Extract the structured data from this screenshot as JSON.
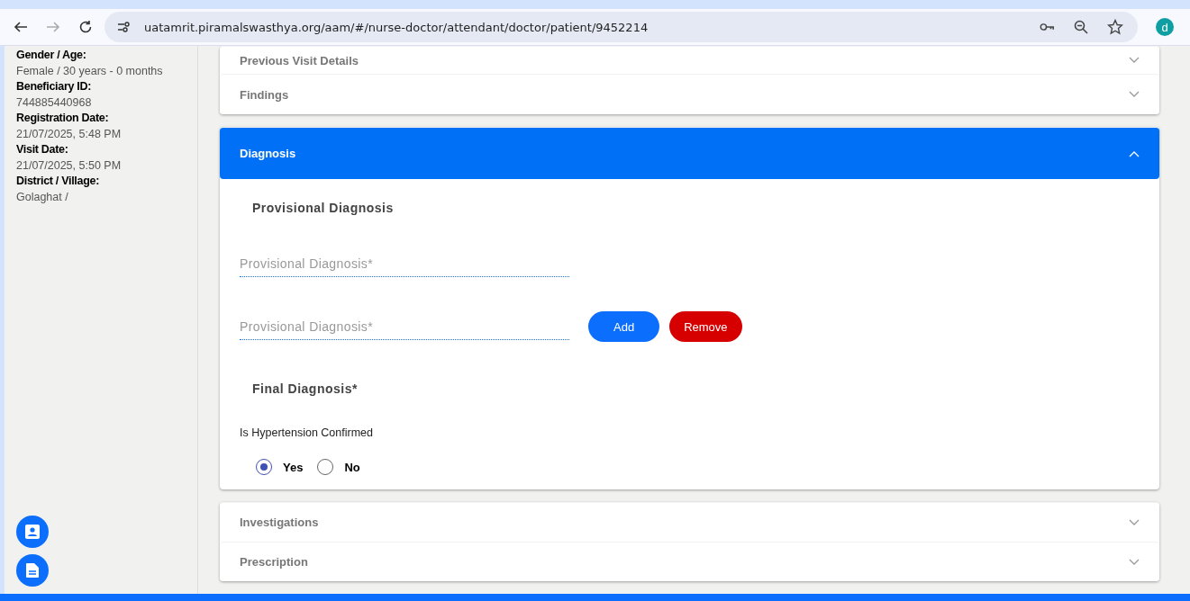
{
  "browser": {
    "url": "uatamrit.piramalswasthya.org/aam/#/nurse-doctor/attendant/doctor/patient/9452214",
    "avatar": "d"
  },
  "patient_info": [
    {
      "label": "Gender / Age:",
      "value": "Female / 30 years - 0 months"
    },
    {
      "label": "Beneficiary ID:",
      "value": "744885440968"
    },
    {
      "label": "Registration Date:",
      "value": "21/07/2025, 5:48 PM"
    },
    {
      "label": "Visit Date:",
      "value": "21/07/2025, 5:50 PM"
    },
    {
      "label": "District / Village:",
      "value": "Golaghat /"
    }
  ],
  "sections_before": [
    {
      "title": "Previous Visit Details",
      "expanded": false
    },
    {
      "title": "Findings",
      "expanded": false
    }
  ],
  "diagnosis": {
    "title": "Diagnosis",
    "expanded": true,
    "provisional_heading": "Provisional Diagnosis",
    "provisional_fields": [
      {
        "placeholder": "Provisional Diagnosis*"
      },
      {
        "placeholder": "Provisional Diagnosis*",
        "buttons": [
          {
            "label": "Add",
            "kind": "add"
          },
          {
            "label": "Remove",
            "kind": "remove"
          }
        ]
      }
    ],
    "final_heading": "Final Diagnosis*",
    "question": "Is Hypertension Confirmed",
    "options": [
      {
        "label": "Yes",
        "selected": true
      },
      {
        "label": "No",
        "selected": false
      }
    ]
  },
  "sections_after": [
    {
      "title": "Investigations",
      "expanded": false
    },
    {
      "title": "Prescription",
      "expanded": false
    }
  ]
}
